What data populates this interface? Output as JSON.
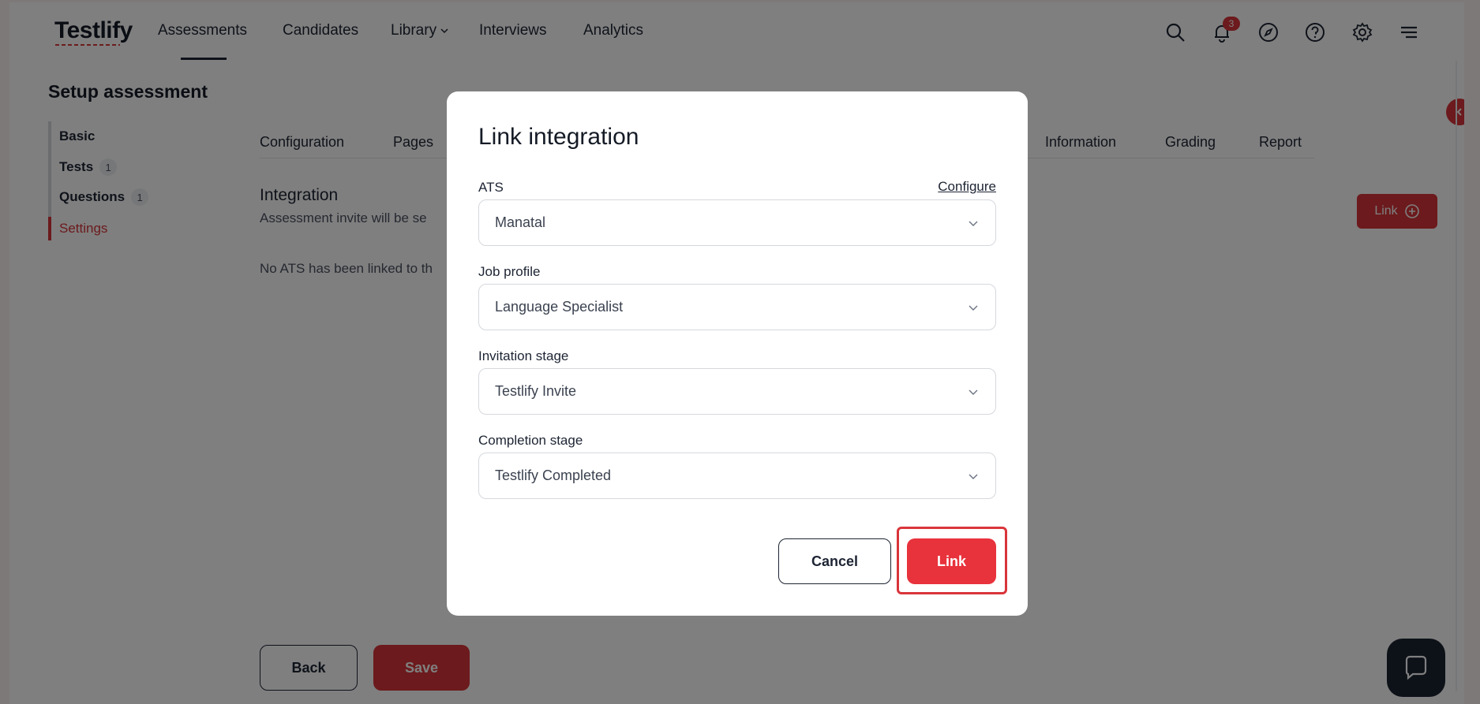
{
  "app": {
    "logo": "Testlify"
  },
  "nav": {
    "items": [
      {
        "label": "Assessments"
      },
      {
        "label": "Candidates"
      },
      {
        "label": "Library"
      },
      {
        "label": "Interviews"
      },
      {
        "label": "Analytics"
      }
    ],
    "notification_count": "3"
  },
  "sidebar": {
    "title": "Setup assessment",
    "items": [
      {
        "label": "Basic",
        "count": ""
      },
      {
        "label": "Tests",
        "count": "1"
      },
      {
        "label": "Questions",
        "count": "1"
      },
      {
        "label": "Settings",
        "count": ""
      }
    ]
  },
  "tabs": [
    {
      "label": "Configuration"
    },
    {
      "label": "Pages"
    },
    {
      "label": "Information"
    },
    {
      "label": "Grading"
    },
    {
      "label": "Report"
    }
  ],
  "integration": {
    "title": "Integration",
    "description": "Assessment invite will be se",
    "empty_text": "No ATS has been linked to th",
    "link_button": "Link"
  },
  "footer": {
    "back": "Back",
    "save": "Save"
  },
  "modal": {
    "title": "Link integration",
    "configure": "Configure",
    "fields": [
      {
        "label": "ATS",
        "value": "Manatal"
      },
      {
        "label": "Job profile",
        "value": "Language Specialist"
      },
      {
        "label": "Invitation stage",
        "value": "Testlify Invite"
      },
      {
        "label": "Completion stage",
        "value": "Testlify Completed"
      }
    ],
    "cancel": "Cancel",
    "confirm": "Link"
  },
  "colors": {
    "accent": "#d9353a",
    "text": "#1d2433",
    "overlay": "rgba(0,0,0,0.5)"
  }
}
